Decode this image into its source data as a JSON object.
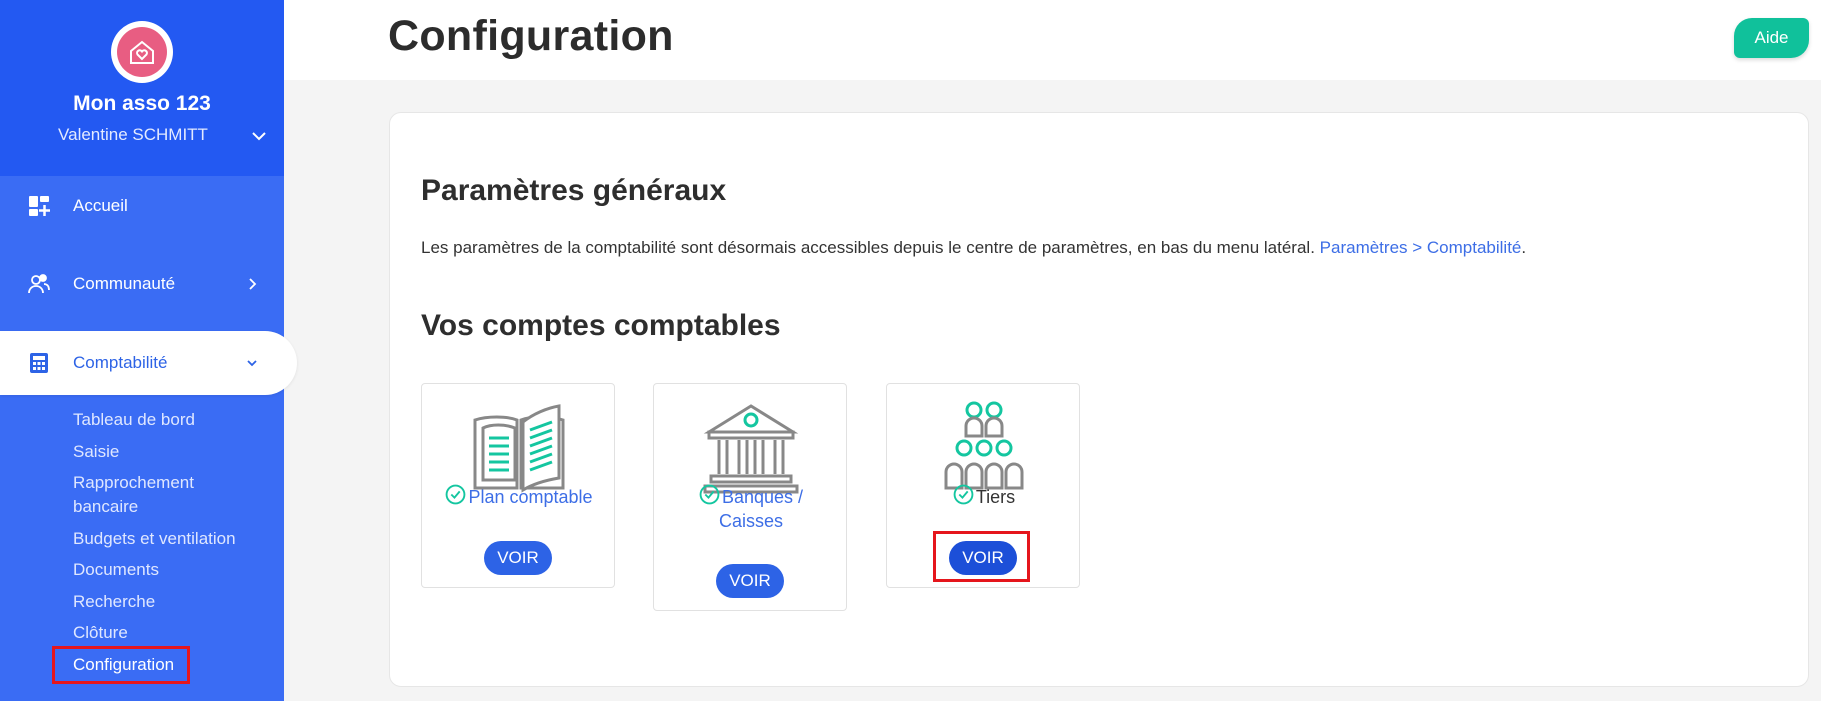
{
  "sidebar": {
    "org_name": "Mon asso 123",
    "user_name": "Valentine SCHMITT",
    "nav": [
      {
        "label": "Accueil",
        "icon": "dashboard-icon"
      },
      {
        "label": "Communauté",
        "icon": "community-icon"
      },
      {
        "label": "Comptabilité",
        "icon": "calculator-icon"
      }
    ],
    "sub_items": [
      "Tableau de bord",
      "Saisie",
      "Rapprochement",
      "bancaire",
      "Budgets et ventilation",
      "Documents",
      "Recherche",
      "Clôture",
      "Configuration"
    ]
  },
  "header": {
    "title": "Configuration",
    "help_label": "Aide"
  },
  "main": {
    "general_title": "Paramètres généraux",
    "info_text": "Les paramètres de la comptabilité sont désormais accessibles depuis le centre de paramètres, en bas du menu latéral. ",
    "info_link": "Paramètres > Comptabilité",
    "info_end": ".",
    "accounts_title": "Vos comptes comptables",
    "tiles": [
      {
        "label": "Plan comptable",
        "button": "VOIR",
        "icon": "book-icon"
      },
      {
        "label_line1": "Banques /",
        "label_line2": "Caisses",
        "button": "VOIR",
        "icon": "bank-icon"
      },
      {
        "label": "Tiers",
        "button": "VOIR",
        "icon": "people-group-icon"
      }
    ]
  },
  "colors": {
    "sidebar": "#3a6cf4",
    "sidebar_head": "#2359f2",
    "accent_blue": "#2d63e6",
    "teal": "#14c6a0",
    "help_green": "#10c19b",
    "highlight_red": "#e5161c"
  }
}
